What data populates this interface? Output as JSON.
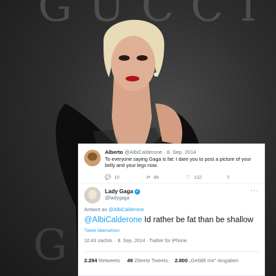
{
  "backdrop": {
    "top_text": "GUCCI",
    "bottom_text": "G"
  },
  "reply_tweet": {
    "name": "Alberto",
    "handle": "@AlbiCalderone",
    "date": "8. Sep. 2014",
    "text": "To everyone saying Gaga is fat: I dare you to post a picture of your belly and your legs now.",
    "replies": "10",
    "retweets": "86",
    "likes": "132"
  },
  "main_tweet": {
    "name": "Lady Gaga",
    "handle": "@ladygaga",
    "reply_to_prefix": "Antwort an",
    "reply_to_mention": "@AlbiCalderone",
    "mention": "@AlbiCalderone",
    "text": "Id rather be fat than be shallow",
    "translate": "Tweet übersetzen",
    "meta": "10:43 nachm. · 8. Sep. 2014 · Twitter for iPhone",
    "retweets_count": "2.294",
    "retweets_label": "Retweets",
    "quotes_count": "49",
    "quotes_label": "Zitierte Tweets",
    "likes_count": "2.800",
    "likes_label": "„Gefällt mir“-Angaben"
  },
  "colors": {
    "link": "#1da1f2",
    "text": "#14171a",
    "muted": "#657786"
  }
}
